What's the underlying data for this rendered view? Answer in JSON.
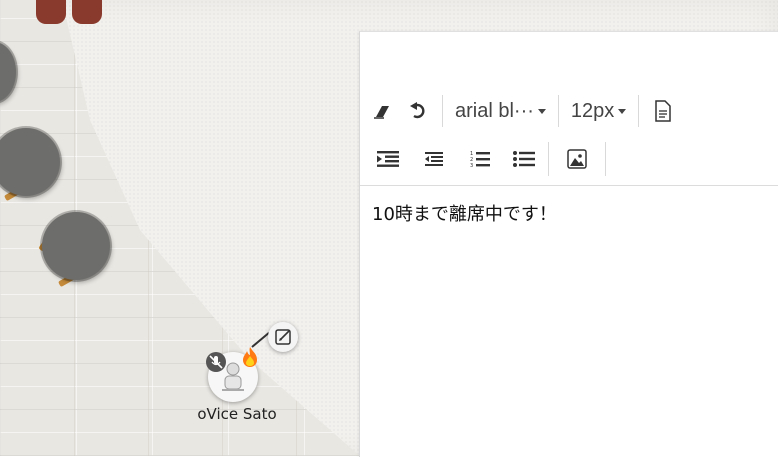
{
  "avatar": {
    "name": "oVice Sato"
  },
  "editor": {
    "toolbar": {
      "font_family": "arial bl···",
      "font_size": "12px"
    },
    "content": "10時まで離席中です！"
  },
  "icons": {
    "eraser": "eraser-icon",
    "undo": "undo-icon",
    "document": "document-icon",
    "indent": "indent-icon",
    "outdent": "outdent-icon",
    "ordered_list": "ordered-list-icon",
    "unordered_list": "unordered-list-icon",
    "image": "image-icon",
    "mic_off": "mic-off-icon",
    "flame": "flame-icon",
    "edit": "edit-icon"
  },
  "colors": {
    "floor": "#e9e7e2",
    "rug": "#f3f1ee",
    "table": "#6d6d6b",
    "table_leg": "#c58b3a",
    "character_feet": "#8a3a2c",
    "panel": "#ffffff"
  }
}
